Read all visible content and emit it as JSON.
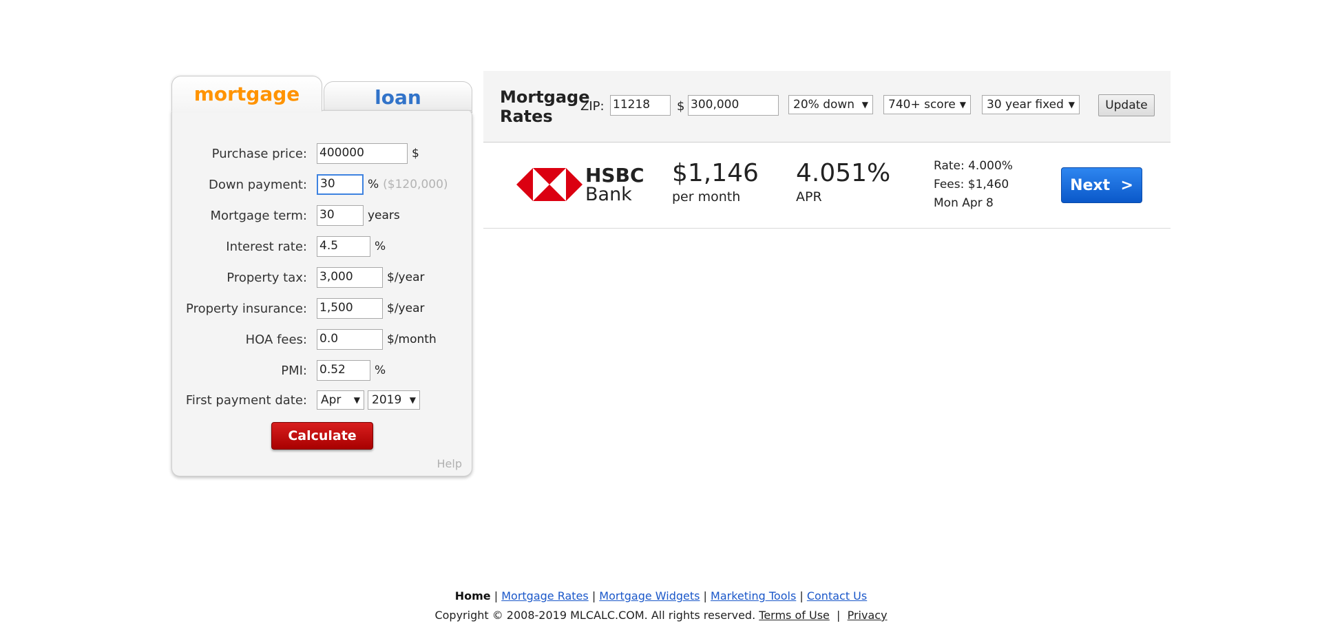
{
  "calculator": {
    "tabs": [
      {
        "label": "mortgage",
        "color": "#ff9300"
      },
      {
        "label": "loan",
        "color": "#3173c9"
      }
    ],
    "fields": [
      {
        "label": "Purchase price:",
        "value": "400000",
        "suffix": "$"
      },
      {
        "label": "Down payment:",
        "value": "30",
        "suffix": "%",
        "hint": "($120,000)"
      },
      {
        "label": "Mortgage term:",
        "value": "30",
        "suffix": "years"
      },
      {
        "label": "Interest rate:",
        "value": "4.5",
        "suffix": "%"
      },
      {
        "label": "Property tax:",
        "value": "3,000",
        "suffix": "$/year"
      },
      {
        "label": "Property insurance:",
        "value": "1,500",
        "suffix": "$/year"
      },
      {
        "label": "HOA fees:",
        "value": "0.0",
        "suffix": "$/month"
      },
      {
        "label": "PMI:",
        "value": "0.52",
        "suffix": "%"
      }
    ],
    "first_payment": {
      "label": "First payment date:",
      "month": "Apr",
      "year": "2019"
    },
    "calculate_label": "Calculate",
    "help_label": "Help"
  },
  "rates": {
    "title_line1": "Mortgage",
    "title_line2": "Rates",
    "zip_label": "ZIP:",
    "zip_value": "11218",
    "amount_label": "$",
    "amount_value": "300,000",
    "down_select": "20% down",
    "score_select": "740+ score",
    "term_select": "30 year fixed",
    "update_label": "Update"
  },
  "offer": {
    "bank_line1": "HSBC",
    "bank_line2": "Bank",
    "payment": "$1,146",
    "payment_sub": "per month",
    "apr": "4.051%",
    "apr_sub": "APR",
    "rate": "Rate: 4.000%",
    "fees": "Fees: $1,460",
    "date": "Mon Apr 8",
    "next_label": "Next  >",
    "logo_color": "#db0011"
  },
  "footer": {
    "home": "Home",
    "links": [
      "Mortgage Rates",
      "Mortgage Widgets",
      "Marketing Tools",
      "Contact Us"
    ],
    "copyright": "Copyright © 2008-2019 MLCALC.COM. All rights reserved.",
    "terms": "Terms of Use",
    "privacy": "Privacy"
  }
}
